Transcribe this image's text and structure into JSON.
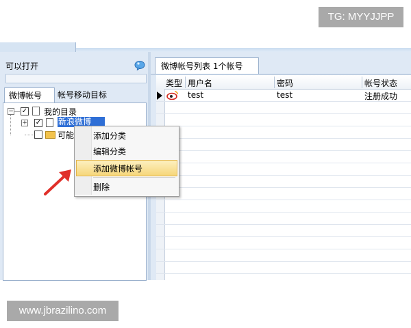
{
  "watermark": {
    "top": "TG: MYYJJPP",
    "bottom": "www.jbrazilino.com"
  },
  "left_panel": {
    "header": "可以打开",
    "tabs": [
      "微博帐号",
      "帐号移动目标"
    ],
    "tree": {
      "root": "我的目录",
      "child_selected": "新浪微博",
      "child_partial": "可能失"
    }
  },
  "context_menu": {
    "items": [
      "添加分类",
      "编辑分类",
      "添加微博帐号",
      "删除"
    ],
    "highlighted": "添加微博帐号"
  },
  "right_panel": {
    "tab": "微博帐号列表 1个帐号",
    "columns": [
      "类型",
      "用户名",
      "密码",
      "帐号状态"
    ],
    "rows": [
      {
        "username": "test",
        "password": "test",
        "status": "注册成功"
      }
    ]
  },
  "colors": {
    "selection": "#2f6fd6",
    "menu_highlight": "#f6d67a",
    "arrow": "#e0302a"
  },
  "icons": [
    "info-balloon-icon",
    "checkbox-icon",
    "document-icon",
    "folder-icon",
    "weibo-icon",
    "row-pointer-icon"
  ]
}
